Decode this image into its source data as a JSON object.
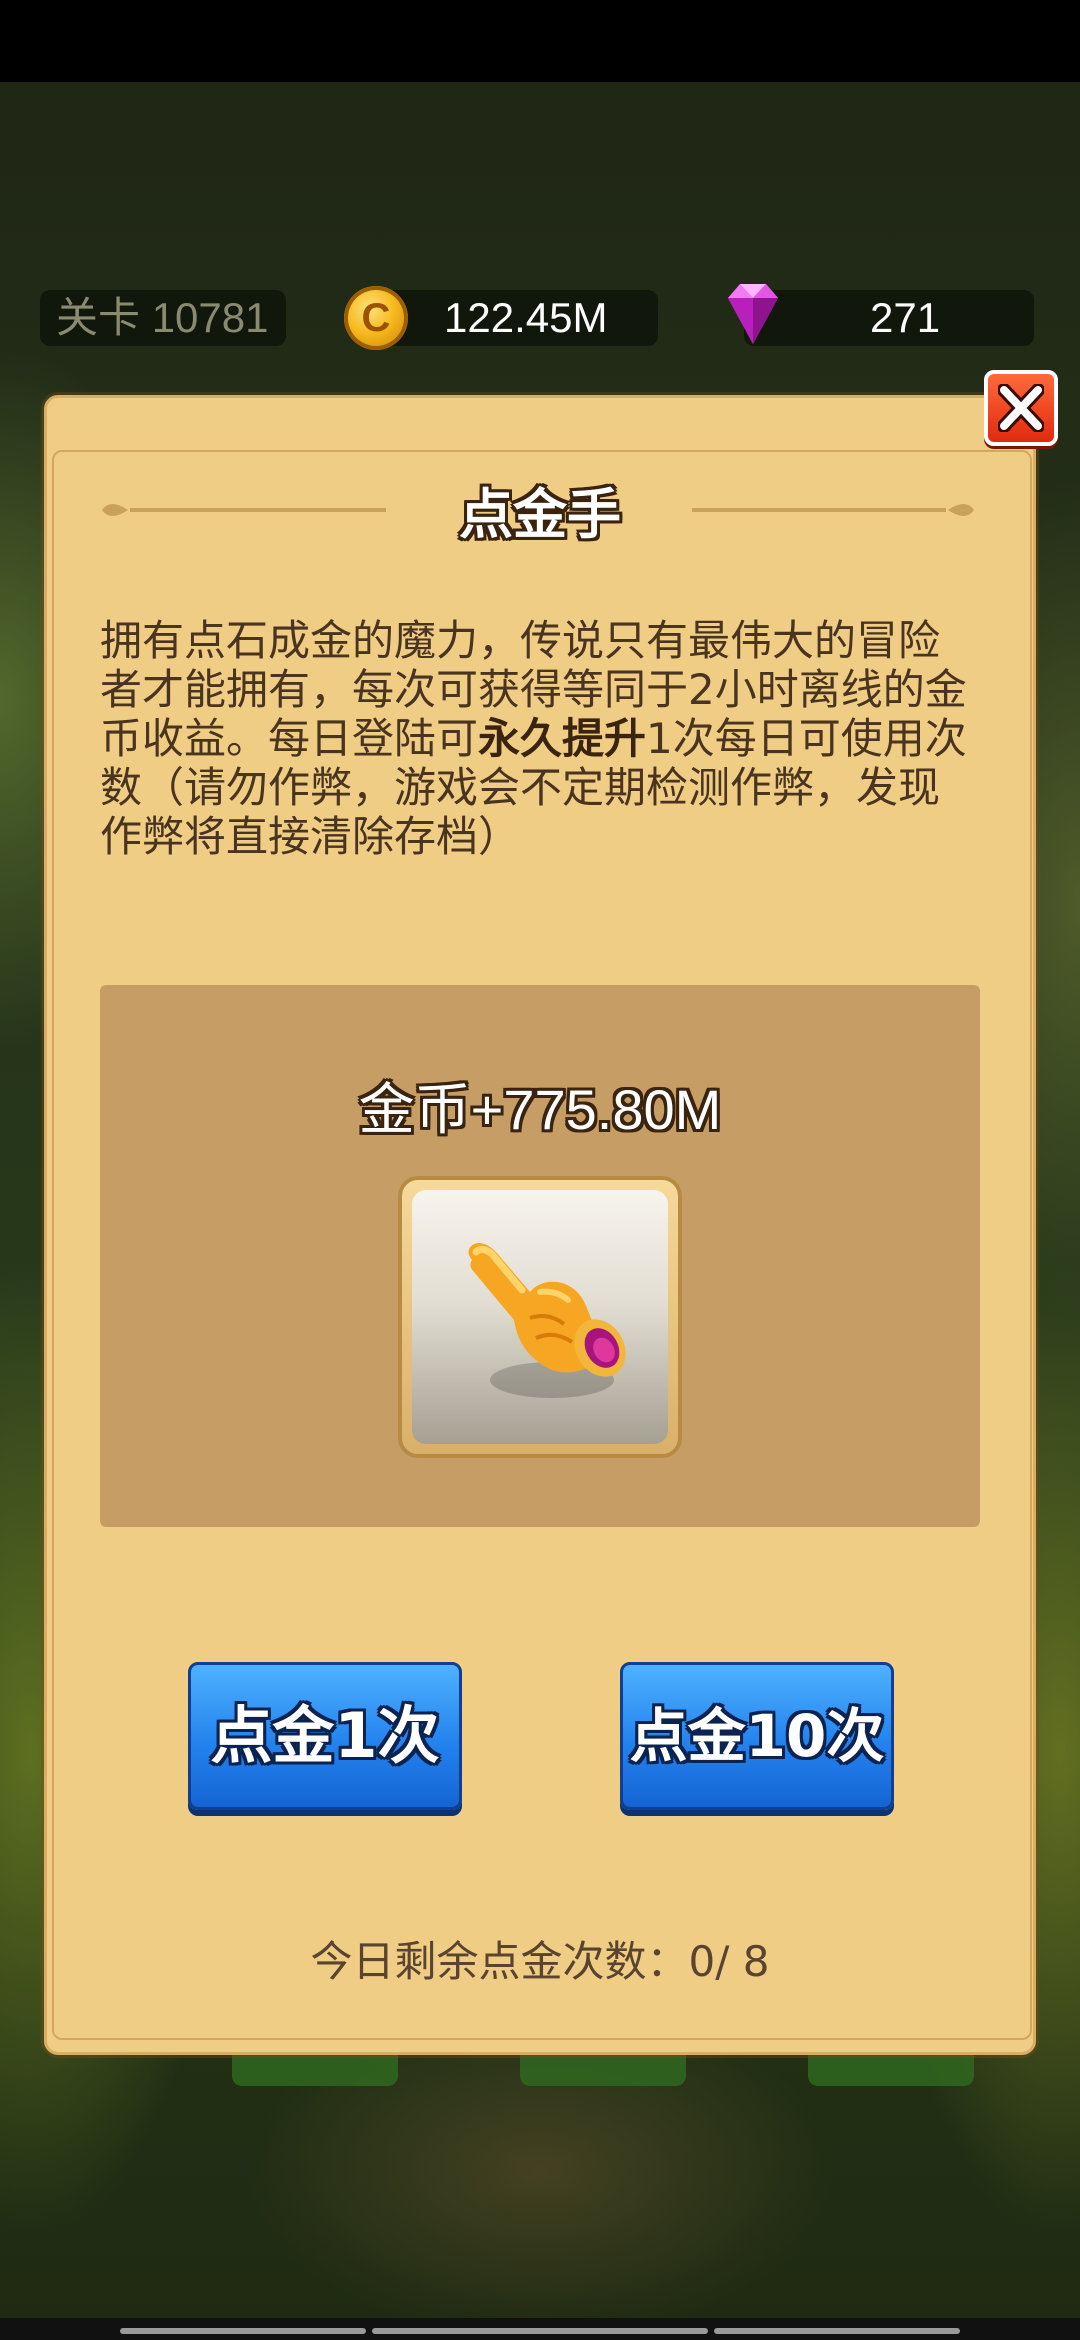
{
  "hud": {
    "level_label": "关卡",
    "level_value": "10781",
    "gold": "122.45M",
    "gems": "271",
    "coin_symbol": "C"
  },
  "dialog": {
    "title": "点金手",
    "description_part1": "拥有点石成金的魔力，传说只有最伟大的冒险者才能拥有，每次可获得等同于2小时离线的金币收益。每日登陆可",
    "description_bold": "永久提升",
    "description_part2": "1次每日可使用次数（请勿作弊，游戏会不定期检测作弊，发现作弊将直接清除存档）",
    "reward": "金币+775.80M",
    "item_icon": "golden-hand-icon",
    "button_one": "点金1次",
    "button_ten": "点金10次",
    "remaining_label": "今日剩余点金次数：0/ 8"
  },
  "colors": {
    "panel_bg": "#f0cd85",
    "reward_panel_bg": "#c69e65",
    "button_blue": "#2383ee",
    "close_red": "#e02a0f"
  }
}
